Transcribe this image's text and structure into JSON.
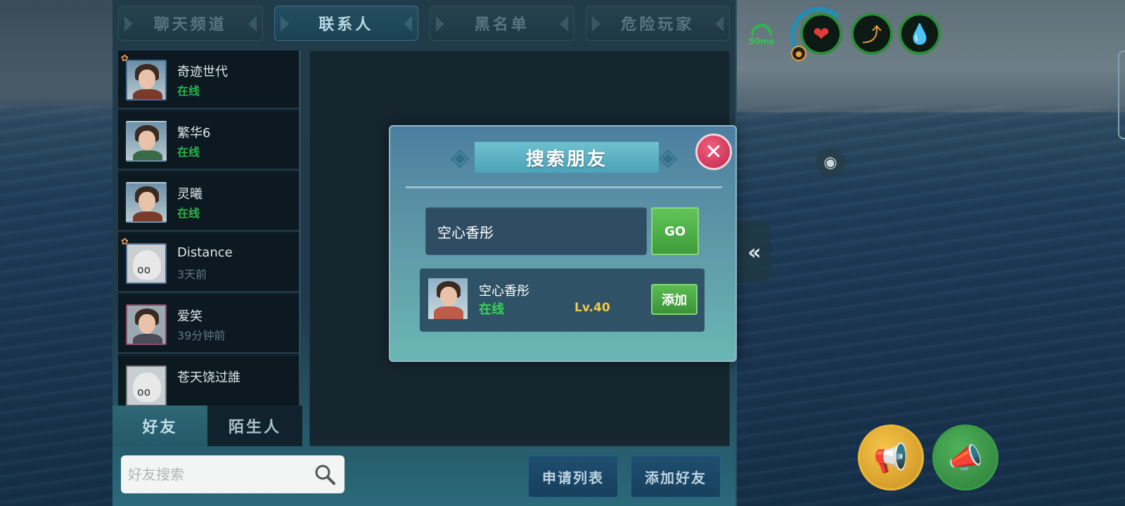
{
  "tabs": [
    {
      "label": "聊天频道"
    },
    {
      "label": "联系人"
    },
    {
      "label": "黑名单"
    },
    {
      "label": "危险玩家"
    }
  ],
  "contacts": [
    {
      "name": "奇迹世代",
      "status": "在线",
      "online": true
    },
    {
      "name": "繁华6",
      "status": "在线",
      "online": true
    },
    {
      "name": "灵曦",
      "status": "在线",
      "online": true
    },
    {
      "name": "Distance",
      "status": "3天前",
      "online": false
    },
    {
      "name": "爱笑",
      "status": "39分钟前",
      "online": false
    },
    {
      "name": "苍天饶过誰",
      "status": "",
      "online": false
    }
  ],
  "list_tabs": [
    {
      "label": "好友"
    },
    {
      "label": "陌生人"
    }
  ],
  "friend_search": {
    "placeholder": "好友搜索"
  },
  "bottom_buttons": {
    "apply_list": "申请列表",
    "add_friend": "添加好友"
  },
  "hud": {
    "ping": "50ms"
  },
  "modal": {
    "title": "搜索朋友",
    "search_value": "空心香彤",
    "go_label": "GO",
    "result": {
      "name": "空心香彤",
      "status": "在线",
      "level": "Lv.40",
      "add_label": "添加"
    }
  },
  "colors": {
    "online": "#2bb34a",
    "level": "#f2c94a",
    "go": "#4caf45",
    "close": "#d23358"
  }
}
